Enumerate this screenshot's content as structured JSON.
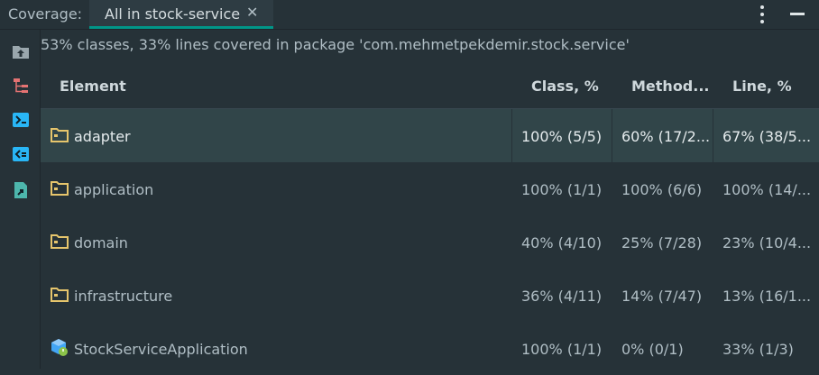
{
  "panel": {
    "title": "Coverage:",
    "tab_label": "All in stock-service",
    "close_glyph": "✕"
  },
  "toolbar": {
    "icons": [
      "import-coverage-icon",
      "flatten-packages-icon",
      "navigate-to-source-icon",
      "autoscroll-from-source-icon",
      "generate-report-icon"
    ]
  },
  "summary": "53% classes, 33% lines covered in package 'com.mehmetpekdemir.stock.service'",
  "table": {
    "headers": {
      "element": "Element",
      "class": "Class, %",
      "method": "Method...",
      "line": "Line, %"
    },
    "rows": [
      {
        "icon": "folder-icon",
        "name": "adapter",
        "class": "100% (5/5)",
        "method": "60% (17/2...",
        "line": "67% (38/5...",
        "selected": true
      },
      {
        "icon": "folder-icon",
        "name": "application",
        "class": "100% (1/1)",
        "method": "100% (6/6)",
        "line": "100% (14/...",
        "selected": false
      },
      {
        "icon": "folder-icon",
        "name": "domain",
        "class": "40% (4/10)",
        "method": "25% (7/28)",
        "line": "23% (10/4...",
        "selected": false
      },
      {
        "icon": "folder-icon",
        "name": "infrastructure",
        "class": "36% (4/11)",
        "method": "14% (7/47)",
        "line": "13% (16/1...",
        "selected": false
      },
      {
        "icon": "spring-boot-class-icon",
        "name": "StockServiceApplication",
        "class": "100% (1/1)",
        "method": "0% (0/1)",
        "line": "33% (1/3)",
        "selected": false
      }
    ]
  },
  "colors": {
    "accent": "#009688",
    "folder": "#e6c56c",
    "tool_icon": "#40c4ff"
  }
}
